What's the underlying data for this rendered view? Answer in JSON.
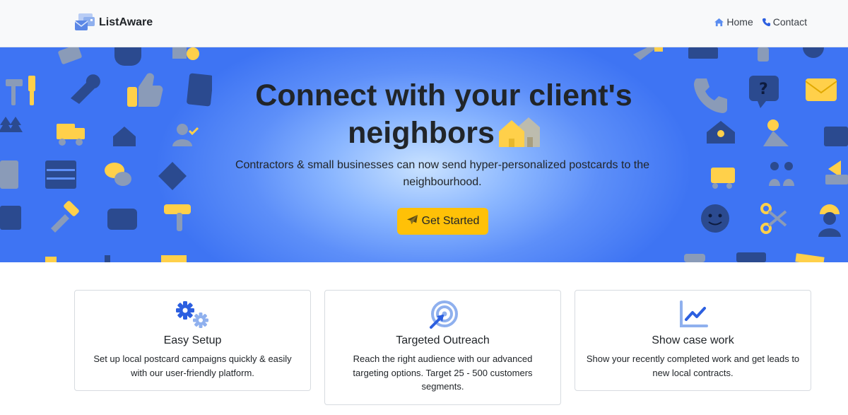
{
  "navbar": {
    "brand": "ListAware",
    "links": [
      {
        "label": "Home",
        "icon": "home-icon"
      },
      {
        "label": "Contact",
        "icon": "phone-icon"
      }
    ]
  },
  "hero": {
    "title_line1": "Connect with your client's",
    "title_line2": "neighbors",
    "subtitle": "Contractors & small businesses can now send hyper-personalized postcards to the neighbourhood.",
    "cta_label": "Get Started",
    "cta_icon": "paper-plane-icon"
  },
  "features": [
    {
      "icon": "gears-icon",
      "title": "Easy Setup",
      "text": "Set up local postcard campaigns quickly & easily with our user-friendly platform."
    },
    {
      "icon": "bullseye-arrow-icon",
      "title": "Targeted Outreach",
      "text": "Reach the right audience with our advanced targeting options. Target 25 - 500 customers segments."
    },
    {
      "icon": "chart-line-icon",
      "title": "Show case work",
      "text": "Show your recently completed work and get leads to new local contracts."
    }
  ],
  "colors": {
    "navbar_bg": "#f8f9fa",
    "hero_blue": "#3e74f3",
    "icon_dark": "#2b4a8f",
    "icon_yellow": "#ffd04a",
    "cta": "#ffc107",
    "accent_blue": "#2c5fe0"
  }
}
